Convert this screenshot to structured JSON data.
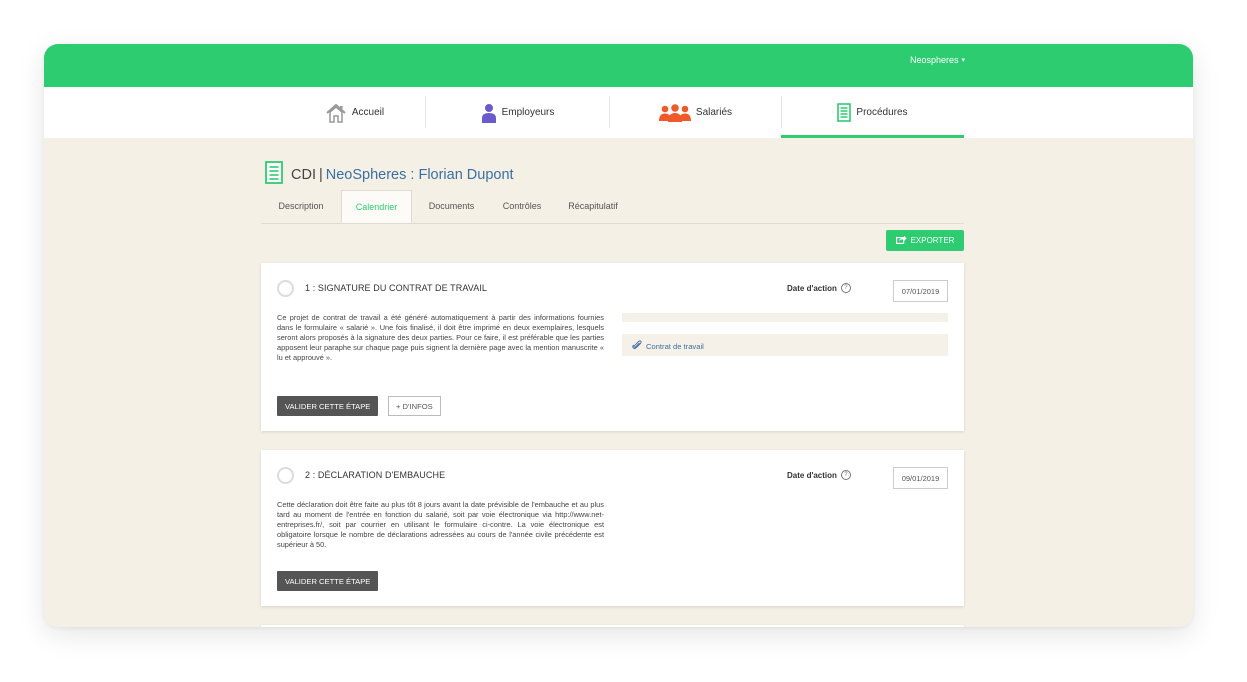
{
  "topbar": {
    "user_label": "Neospheres",
    "caret": "▾"
  },
  "nav": {
    "items": [
      {
        "label": "Accueil"
      },
      {
        "label": "Employeurs"
      },
      {
        "label": "Salariés"
      },
      {
        "label": "Procédures"
      }
    ],
    "active_index": 3
  },
  "page": {
    "title_prefix": "CDI",
    "title_separator": "|",
    "title_main": "NeoSpheres : Florian Dupont"
  },
  "tabs": [
    "Description",
    "Calendrier",
    "Documents",
    "Contrôles",
    "Récapitulatif"
  ],
  "active_tab": "Calendrier",
  "export_label": "EXPORTER",
  "steps": [
    {
      "title": "1 : SIGNATURE DU CONTRAT DE TRAVAIL",
      "date_label": "Date d'action",
      "date_value": "07/01/2019",
      "description": "Ce projet de contrat de travail a été généré automatiquement à partir des informations fournies dans le formulaire « salarié ». Une fois finalisé, il doit être imprimé en deux exemplaires, lesquels seront alors proposés à la signature des deux parties. Pour ce faire, il est préférable que les parties apposent leur paraphe sur chaque page puis signent la dernière page avec la mention manuscrite « lu et approuvé ».",
      "validate_label": "VALIDER CETTE ÉTAPE",
      "more_label": "+ D'INFOS",
      "document_label": "Contrat de travail"
    },
    {
      "title": "2 : DÉCLARATION D'EMBAUCHE",
      "date_label": "Date d'action",
      "date_value": "09/01/2019",
      "description": "Cette déclaration doit être faite au plus tôt 8 jours avant la date prévisible de l'embauche et au plus tard au moment de l'entrée en fonction du salarié, soit par voie électronique via http://www.net-entreprises.fr/, soit par courrier en utilisant le formulaire ci-contre. La voie électronique est obligatoire lorsque le nombre de déclarations adressées au cours de l'année civile précédente est supérieur à 50.",
      "validate_label": "VALIDER CETTE ÉTAPE"
    }
  ],
  "colors": {
    "brand_green": "#2ecc71",
    "background": "#f5f0e6",
    "link_blue": "#3a6fa3",
    "dark_button": "#555555"
  }
}
